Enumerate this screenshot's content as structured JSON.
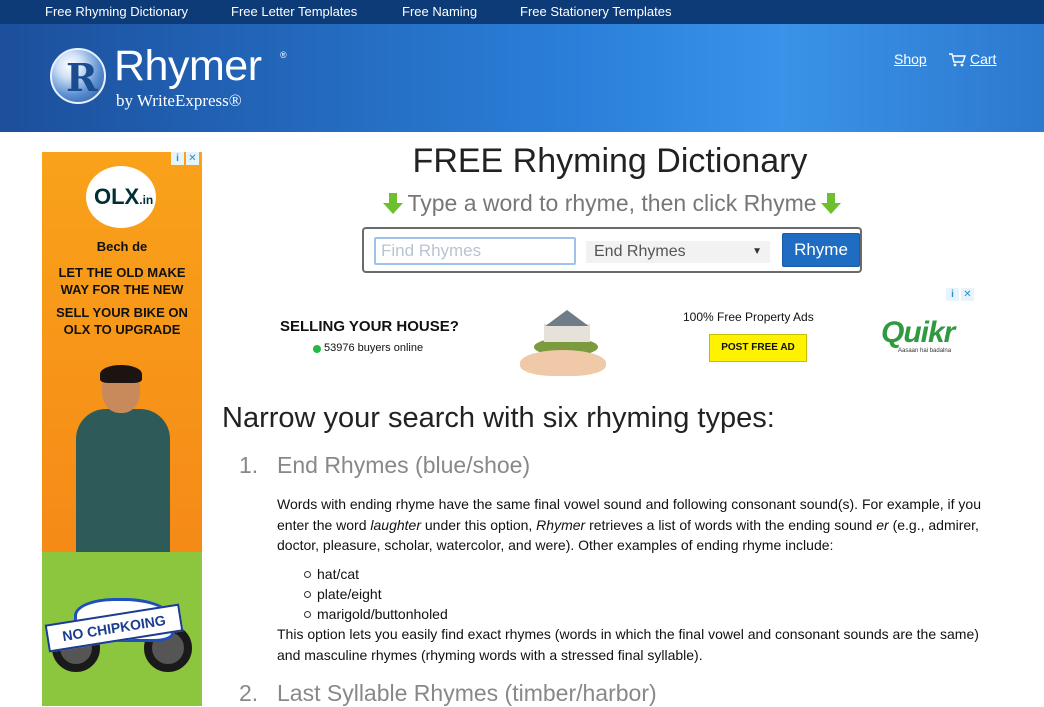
{
  "topnav": {
    "links": [
      {
        "label": "Free Rhyming Dictionary"
      },
      {
        "label": "Free Letter Templates"
      },
      {
        "label": "Free Naming"
      },
      {
        "label": "Free Stationery Templates"
      }
    ]
  },
  "header": {
    "logo_word": "Rhymer",
    "logo_reg": "®",
    "logo_by": "by WriteExpress®",
    "shop_label": "Shop",
    "cart_label": "Cart",
    "background_color": "#2a7fd9"
  },
  "left_ad": {
    "brand": "OLX",
    "brand_suffix": ".in",
    "line1": "Bech de",
    "line2": "LET THE OLD MAKE",
    "line3": "WAY FOR THE NEW",
    "line4": "SELL YOUR BIKE ON",
    "line5": "OLX TO UPGRADE",
    "badge": "NO CHIPKOING"
  },
  "main": {
    "title": "FREE Rhyming Dictionary",
    "subtitle": "Type a word to rhyme, then click Rhyme"
  },
  "search": {
    "placeholder": "Find Rhymes",
    "value": "",
    "selected_type": "End Rhymes",
    "button_label": "Rhyme",
    "button_color": "#1f6cc3"
  },
  "banner_ad": {
    "headline": "SELLING YOUR HOUSE?",
    "buyers": "53976 buyers online",
    "offer": "100% Free Property Ads",
    "cta": "POST FREE AD",
    "brand": "Quikr",
    "tagline": "Aasaan hai badalna"
  },
  "content": {
    "section_heading": "Narrow your search with six rhyming types:",
    "items": [
      {
        "number": "1.",
        "title": "End Rhymes (blue/shoe)",
        "intro_1": "Words with ending rhyme have the same final vowel sound and following consonant sound(s). For example, if you enter the word ",
        "intro_em1": "laughter",
        "intro_2": " under this option, ",
        "intro_em2": "Rhymer",
        "intro_3": " retrieves a list of words with the ending sound ",
        "intro_em3": "er",
        "intro_4": " (e.g., admirer, doctor, pleasure, scholar, watercolor, and were). Other examples of ending rhyme include:",
        "examples": [
          "hat/cat",
          "plate/eight",
          "marigold/buttonholed"
        ],
        "outro": "This option lets you easily find exact rhymes (words in which the final vowel and consonant sounds are the same) and masculine rhymes (rhyming words with a stressed final syllable)."
      },
      {
        "number": "2.",
        "title": "Last Syllable Rhymes (timber/harbor)"
      }
    ]
  }
}
